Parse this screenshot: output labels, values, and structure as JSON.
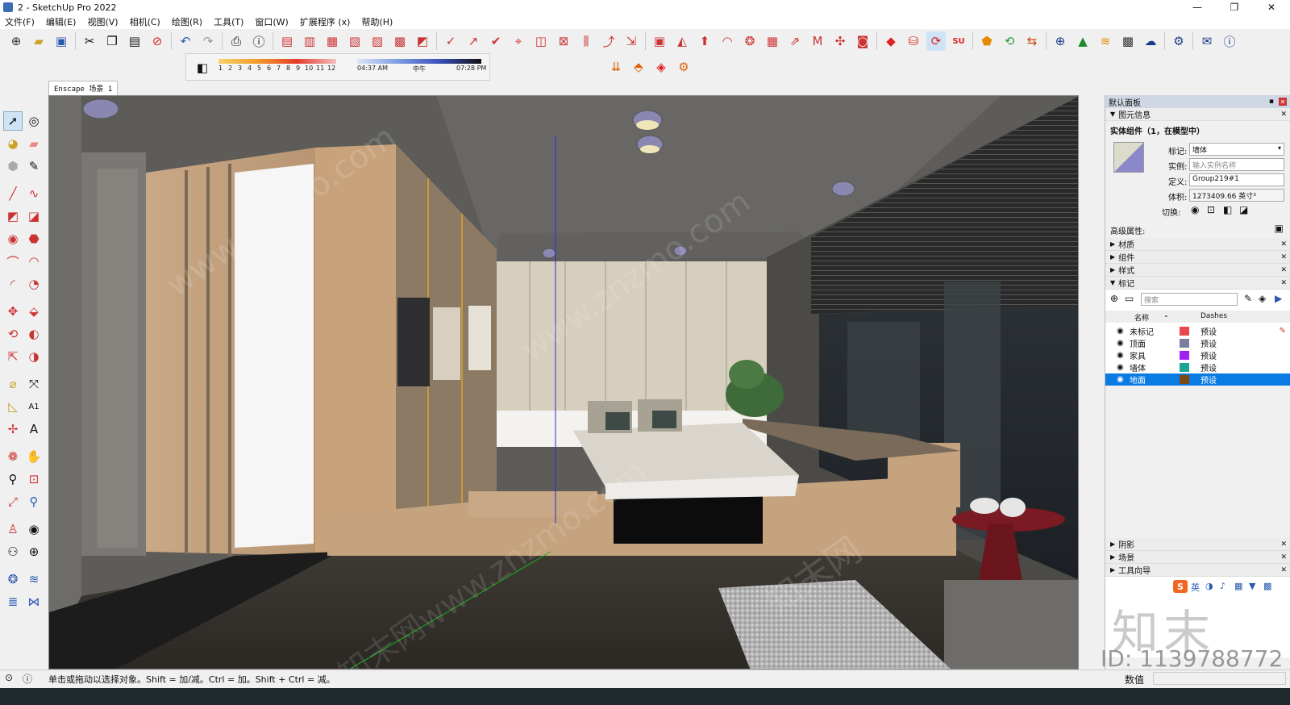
{
  "window": {
    "title": "2 - SketchUp Pro 2022",
    "minimize": "—",
    "restore": "❐",
    "close": "✕"
  },
  "menu": [
    "文件(F)",
    "编辑(E)",
    "视图(V)",
    "相机(C)",
    "绘图(R)",
    "工具(T)",
    "窗口(W)",
    "扩展程序 (x)",
    "帮助(H)"
  ],
  "shadow_toolbar": {
    "months": [
      "1",
      "2",
      "3",
      "4",
      "5",
      "6",
      "7",
      "8",
      "9",
      "10",
      "11",
      "12"
    ],
    "time_start": "04:37 AM",
    "time_mid": "中午",
    "time_end": "07:28 PM"
  },
  "scene_tab": "Enscape 场景 1",
  "viewport_watermarks": [
    "www.znzmo.com",
    "知末网",
    "www.znzmo.com",
    "知末网www.znzmo.com"
  ],
  "panel": {
    "title": "默认面板",
    "entity_info": {
      "header": "图元信息",
      "type": "实体组件（1，在模型中）",
      "tag_label": "标记:",
      "tag_value": "墙体",
      "instance_label": "实例:",
      "instance_placeholder": "输入实例名称",
      "definition_label": "定义:",
      "definition_value": "Group219#1",
      "volume_label": "体积:",
      "volume_value": "1273409.66 英寸³",
      "toggle_label": "切换:",
      "advanced_label": "高级属性:"
    },
    "sections": [
      "材质",
      "组件",
      "样式",
      "标记"
    ],
    "tags": {
      "search_placeholder": "搜索",
      "col_name": "名称",
      "col_dashes": "Dashes",
      "rows": [
        {
          "name": "未标记",
          "color": "#e8474c",
          "dashes": "预设"
        },
        {
          "name": "顶面",
          "color": "#7a7e9c",
          "dashes": "预设"
        },
        {
          "name": "家具",
          "color": "#a020f0",
          "dashes": "预设"
        },
        {
          "name": "墙体",
          "color": "#1aa692",
          "dashes": "预设"
        },
        {
          "name": "地面",
          "color": "#7a4a17",
          "dashes": "预设"
        }
      ]
    },
    "bottom_sections": [
      "阴影",
      "场景",
      "工具向导"
    ],
    "ime": {
      "lang": "英"
    },
    "brand": "知末",
    "id_text": "ID: 1139788772"
  },
  "status": {
    "message": "单击或拖动以选择对象。Shift = 加/减。Ctrl = 加。Shift + Ctrl = 减。",
    "measure_label": "数值"
  }
}
